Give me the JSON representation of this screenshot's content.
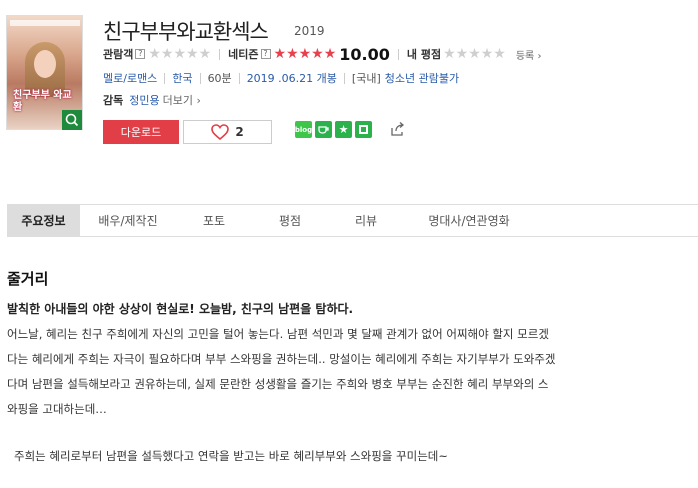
{
  "poster": {
    "title_overlay": "친구부부 와교환",
    "zoom_icon": "search-icon"
  },
  "movie": {
    "title": "친구부부와교환섹스",
    "year": "2019"
  },
  "ratings": {
    "audience_label": "관람객",
    "audience_help": "?",
    "netizen_label": "네티즌",
    "netizen_help": "?",
    "netizen_score": "10.00",
    "netizen_value": 10.0,
    "my_label": "내 평점",
    "register": "등록",
    "star_full_color": "#e8414c",
    "star_empty_color": "#cfcfcf"
  },
  "info": {
    "genre": "멜로/로맨스",
    "country": "한국",
    "runtime": "60분",
    "release": "2019 .06.21 개봉",
    "rating_prefix": "[국내]",
    "rating": "청소년 관람불가"
  },
  "director": {
    "label": "감독",
    "name": "정민용",
    "more": "더보기"
  },
  "actions": {
    "download": "다운로드",
    "like_count": "2",
    "download_color": "#e23e48"
  },
  "share": {
    "blog": "blog"
  },
  "tabs": [
    "주요정보",
    "배우/제작진",
    "포토",
    "평점",
    "리뷰",
    "명대사/연관영화"
  ],
  "synopsis": {
    "heading": "줄거리",
    "subtitle": "발칙한 아내들의 야한 상상이 현실로! 오늘밤, 친구의 남편을 탐하다.",
    "lines": [
      "어느날, 혜리는 친구 주희에게 자신의 고민을 털어 놓는다. 남편 석민과 몇 달째 관계가 없어 어찌해야 할지 모르겠",
      "다는 혜리에게 주희는 자극이 필요하다며 부부 스와핑을 권하는데.. 망설이는 혜리에게 주희는 자기부부가 도와주겠",
      "다며 남편을 설득해보라고 권유하는데, 실제 문란한 성생활을 즐기는 주희와 병호 부부는 순진한 혜리 부부와의 스",
      "와핑을 고대하는데…"
    ],
    "extra": "주희는 혜리로부터 남편을 설득했다고 연락을 받고는 바로 혜리부부와 스와핑을 꾸미는데~"
  }
}
